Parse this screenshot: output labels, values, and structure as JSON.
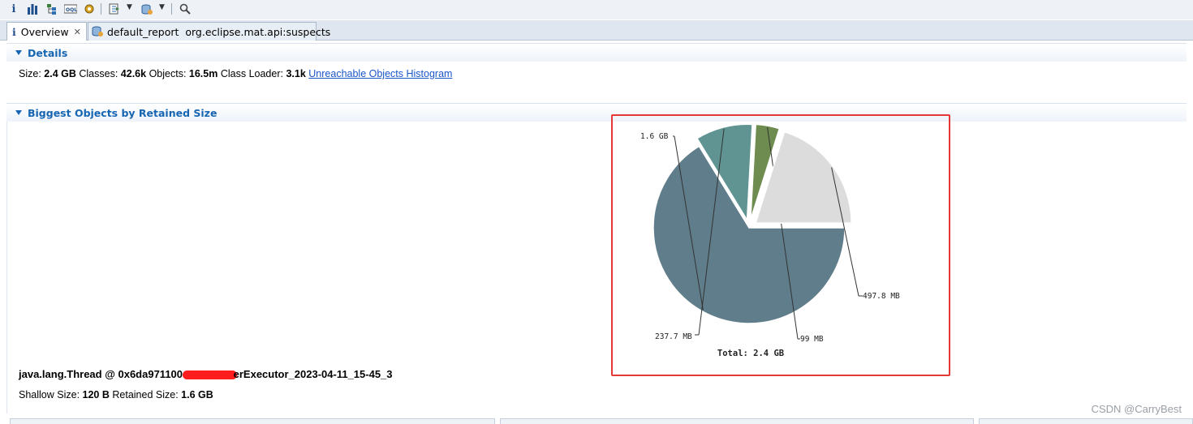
{
  "toolbar": {
    "icons": [
      "info-icon",
      "histogram-icon",
      "dominator-tree-icon",
      "oql-icon",
      "thread-overview-icon",
      "run-report-icon",
      "query-browser-icon",
      "search-icon"
    ]
  },
  "tabs": [
    {
      "label": "Overview",
      "active": true
    },
    {
      "label": "default_report  org.eclipse.mat.api:suspects",
      "active": false
    }
  ],
  "details": {
    "header": "Details",
    "size_label": "Size:",
    "size_value": "2.4 GB",
    "classes_label": "Classes:",
    "classes_value": "42.6k",
    "objects_label": "Objects:",
    "objects_value": "16.5m",
    "loader_label": "Class Loader:",
    "loader_value": "3.1k",
    "histogram_link": "Unreachable Objects Histogram"
  },
  "biggest": {
    "header": "Biggest Objects by Retained Size"
  },
  "chart_data": {
    "type": "pie",
    "unit": "MB",
    "slices": [
      {
        "label": "1.6 GB",
        "value": 1638.4,
        "color": "#607d8b"
      },
      {
        "label": "237.7 MB",
        "value": 237.7,
        "color": "#5f9492"
      },
      {
        "label": "99 MB",
        "value": 99,
        "color": "#6e8c4f"
      },
      {
        "label": "497.8 MB",
        "value": 497.8,
        "color": "#dcdcdc"
      }
    ],
    "total_label": "Total: 2.4 GB"
  },
  "selected_object": {
    "title_prefix": "java.lang.Thread @ 0x6da971100 ",
    "title_suffix": "erExecutor_2023-04-11_15-45_3",
    "shallow_label": "Shallow Size:",
    "shallow_value": "120 B",
    "retained_label": "Retained Size:",
    "retained_value": "1.6 GB"
  },
  "colors": {
    "accent": "#1565b3",
    "highlight_box": "#e53935"
  },
  "watermark": "CSDN @CarryBest"
}
